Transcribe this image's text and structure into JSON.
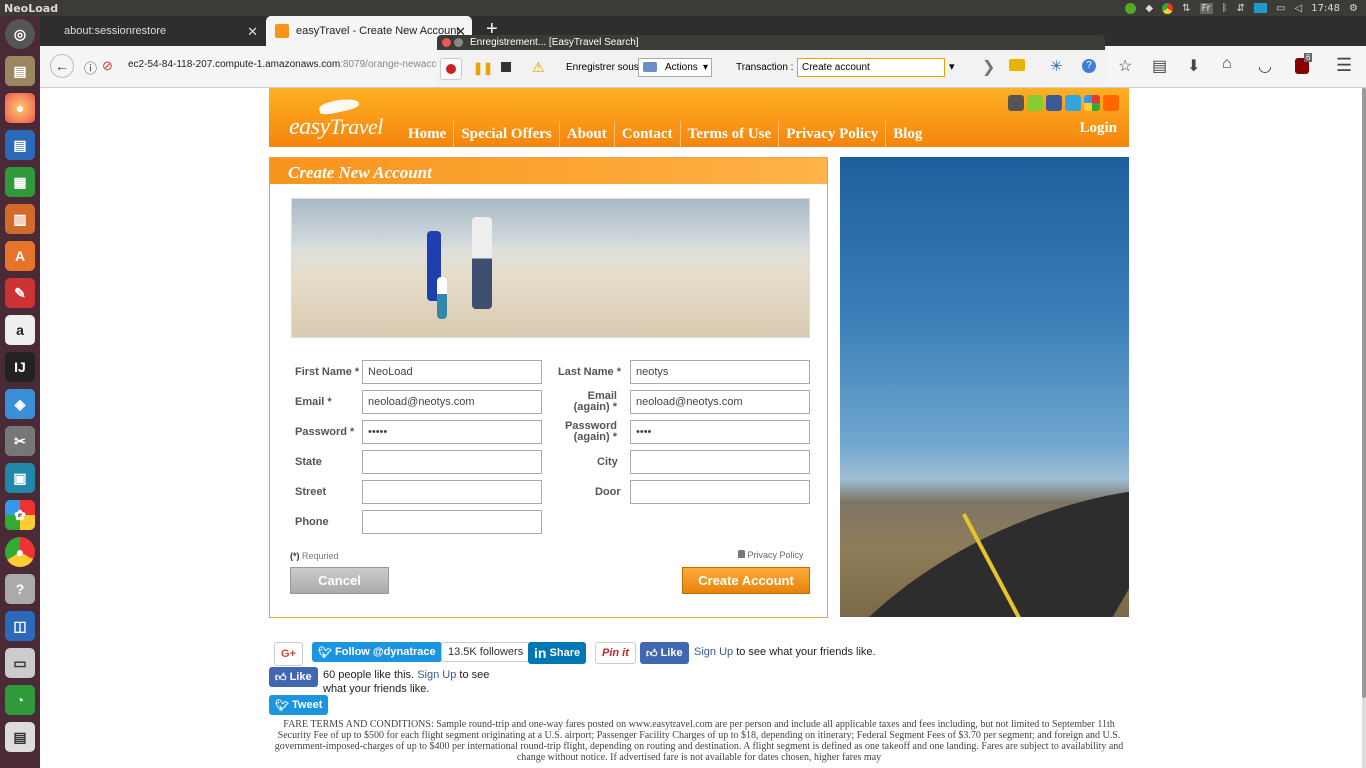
{
  "system": {
    "app_title": "NeoLoad",
    "clock": "17:48",
    "keyboard": "Fr"
  },
  "tabs": [
    {
      "label": "about:sessionrestore"
    },
    {
      "label": "easyTravel - Create New Account"
    }
  ],
  "address": {
    "host": "ec2-54-84-118-207.compute-1.amazonaws.com",
    "path": ":8079/orange-newaccount.jsf"
  },
  "recorder": {
    "title": "Enregistrement... [EasyTravel Search]",
    "save_as_label": "Enregistrer sous :",
    "save_as_value": "Actions",
    "transaction_label": "Transaction :",
    "transaction_value": "Create account"
  },
  "toolbar": {
    "ublock_badge": "6"
  },
  "site": {
    "logo_main": "easy",
    "logo_sub": "Travel",
    "nav": [
      "Home",
      "Special Offers",
      "About",
      "Contact",
      "Terms of Use",
      "Privacy Policy",
      "Blog"
    ],
    "login": "Login"
  },
  "form": {
    "title": "Create New Account",
    "first_name_label": "First Name",
    "first_name_value": "NeoLoad",
    "last_name_label": "Last Name",
    "last_name_value": "neotys",
    "email_label": "Email",
    "email_value": "neoload@neotys.com",
    "email_again_label_1": "Email",
    "email_again_label_2": "(again)",
    "email_again_value": "neoload@neotys.com",
    "password_label": "Password",
    "password_value": "•••••",
    "password_again_label_1": "Password",
    "password_again_label_2": "(again)",
    "password_again_value": "••••",
    "state_label": "State",
    "city_label": "City",
    "street_label": "Street",
    "door_label": "Door",
    "phone_label": "Phone",
    "required_mark": "*",
    "required_note_star": "(*)",
    "required_note": "Requried",
    "privacy_link": "Privacy Policy",
    "cancel": "Cancel",
    "create": "Create Account"
  },
  "share": {
    "gplus": "G+",
    "follow": "Follow @dynatrace",
    "followers": "13.5K followers",
    "linkedin": "Share",
    "pinit": "Pin it",
    "fb_like": "Like",
    "fb_signup": "Sign Up",
    "fb_signup_rest": " to see what your friends like.",
    "fb_like2": "Like",
    "fb_count_text": "60 people like this.",
    "fb_signup2": "Sign Up",
    "fb_signup2_rest": " to see",
    "fb_signup2_line2": "what your friends like.",
    "tweet": "Tweet"
  },
  "terms_text": "FARE TERMS AND CONDITIONS: Sample round-trip and one-way fares posted on www.easytravel.com are per person and include all applicable taxes and fees including, but not limited to September 11th Security Fee of up to $500 for each flight segment originating at a U.S. airport; Passenger Facility Charges of up to $18, depending on itinerary; Federal Segment Fees of $3.70 per segment; and foreign and U.S. government-imposed-charges of up to $400 per international round-trip flight, depending on routing and destination. A flight segment is defined as one takeoff and one landing. Fares are subject to availability and change without notice. If advertised fare is not available for dates chosen, higher fares may"
}
